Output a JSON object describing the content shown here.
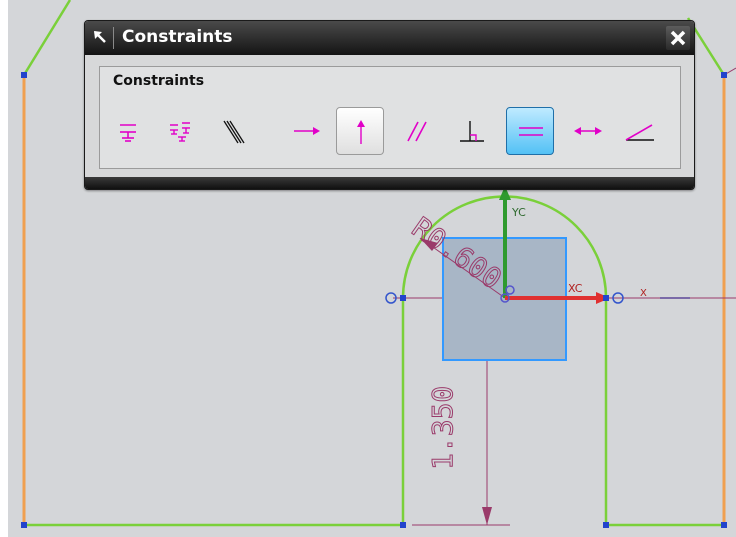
{
  "dialog": {
    "title": "Constraints",
    "group_label": "Constraints",
    "buttons": [
      {
        "name": "fixed",
        "icon": "fixed-icon",
        "state": "normal"
      },
      {
        "name": "fully-fixed",
        "icon": "fully-fixed-icon",
        "state": "normal"
      },
      {
        "name": "collinear",
        "icon": "collinear-icon",
        "state": "normal"
      },
      {
        "name": "horizontal",
        "icon": "horizontal-icon",
        "state": "normal"
      },
      {
        "name": "vertical",
        "icon": "vertical-icon",
        "state": "pressed"
      },
      {
        "name": "parallel",
        "icon": "parallel-icon",
        "state": "normal"
      },
      {
        "name": "perpendicular",
        "icon": "perpendicular-icon",
        "state": "normal"
      },
      {
        "name": "equal-length",
        "icon": "equal-length-icon",
        "state": "active"
      },
      {
        "name": "constant-length",
        "icon": "constant-length-icon",
        "state": "normal"
      },
      {
        "name": "constant-angle",
        "icon": "constant-angle-icon",
        "state": "normal"
      }
    ]
  },
  "sketch": {
    "radius_dimension": "R0.600",
    "vertical_dimension": "1.350",
    "axis_labels": {
      "yc": "YC",
      "xc": "XC",
      "x": "X"
    }
  },
  "colors": {
    "canvas": "#d4d6d9",
    "curve_green": "#7ad03a",
    "reference_orange": "#f0a050",
    "dimension_maroon": "#9a3a6a",
    "icon_magenta": "#e100c8",
    "axis_red": "#e03030",
    "axis_green": "#2f9a2f",
    "selection_blue": "#3399ff"
  }
}
